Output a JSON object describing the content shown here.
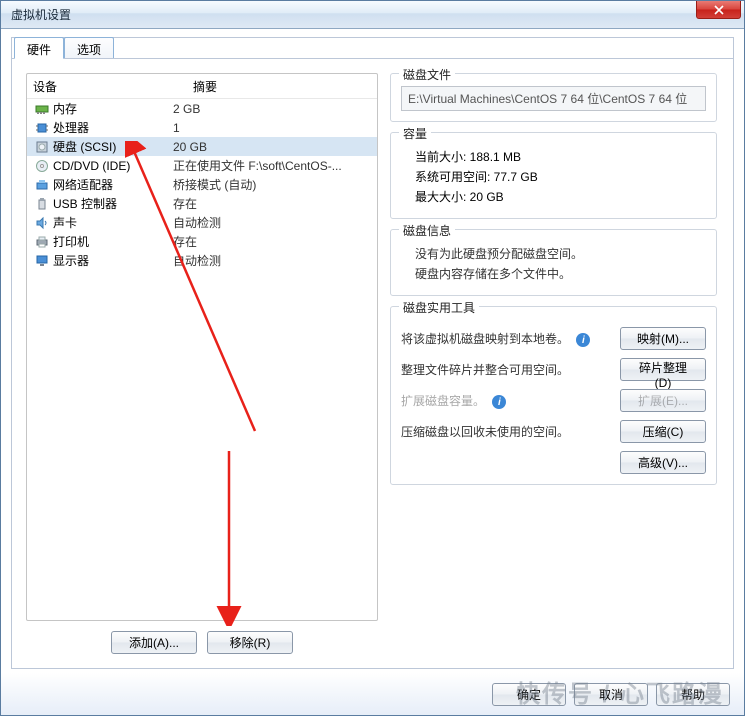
{
  "window": {
    "title": "虚拟机设置"
  },
  "tabs": {
    "hardware": "硬件",
    "options": "选项"
  },
  "deviceList": {
    "headers": {
      "device": "设备",
      "summary": "摘要"
    },
    "rows": [
      {
        "icon": "memory-icon",
        "name": "内存",
        "summary": "2 GB"
      },
      {
        "icon": "cpu-icon",
        "name": "处理器",
        "summary": "1"
      },
      {
        "icon": "disk-icon",
        "name": "硬盘 (SCSI)",
        "summary": "20 GB",
        "selected": true
      },
      {
        "icon": "cd-icon",
        "name": "CD/DVD (IDE)",
        "summary": "正在使用文件 F:\\soft\\CentOS-..."
      },
      {
        "icon": "network-icon",
        "name": "网络适配器",
        "summary": "桥接模式 (自动)"
      },
      {
        "icon": "usb-icon",
        "name": "USB 控制器",
        "summary": "存在"
      },
      {
        "icon": "sound-icon",
        "name": "声卡",
        "summary": "自动检测"
      },
      {
        "icon": "printer-icon",
        "name": "打印机",
        "summary": "存在"
      },
      {
        "icon": "display-icon",
        "name": "显示器",
        "summary": "自动检测"
      }
    ],
    "addBtn": "添加(A)...",
    "removeBtn": "移除(R)"
  },
  "diskFile": {
    "title": "磁盘文件",
    "path": "E:\\Virtual Machines\\CentOS 7 64 位\\CentOS 7 64 位"
  },
  "capacity": {
    "title": "容量",
    "current": "当前大小: 188.1 MB",
    "free": "系统可用空间: 77.7 GB",
    "max": "最大大小: 20 GB"
  },
  "diskInfo": {
    "title": "磁盘信息",
    "line1": "没有为此硬盘预分配磁盘空间。",
    "line2": "硬盘内容存储在多个文件中。"
  },
  "diskTools": {
    "title": "磁盘实用工具",
    "mapDesc": "将该虚拟机磁盘映射到本地卷。",
    "mapBtn": "映射(M)...",
    "defragDesc": "整理文件碎片并整合可用空间。",
    "defragBtn": "碎片整理(D)",
    "expandDesc": "扩展磁盘容量。",
    "expandBtn": "扩展(E)...",
    "compactDesc": "压缩磁盘以回收未使用的空间。",
    "compactBtn": "压缩(C)",
    "advancedBtn": "高级(V)..."
  },
  "footer": {
    "ok": "确定",
    "cancel": "取消",
    "help": "帮助"
  },
  "watermark": "快传号 / 心飞路漫"
}
